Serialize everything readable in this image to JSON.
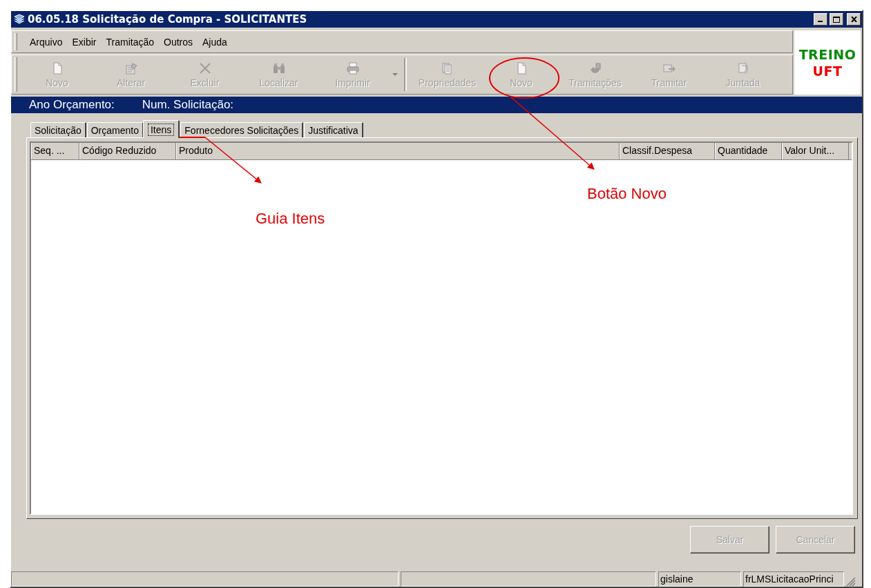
{
  "window": {
    "title": "06.05.18 Solicitação de Compra - SOLICITANTES"
  },
  "menu": [
    "Arquivo",
    "Exibir",
    "Tramitação",
    "Outros",
    "Ajuda"
  ],
  "toolbar": [
    {
      "kind": "button",
      "label": "Novo",
      "disabled": true
    },
    {
      "kind": "button",
      "label": "Alterar",
      "disabled": true
    },
    {
      "kind": "button",
      "label": "Excluir",
      "disabled": true
    },
    {
      "kind": "button",
      "label": "Localizar",
      "disabled": true
    },
    {
      "kind": "button",
      "label": "Imprimir",
      "disabled": true,
      "dropdown": true
    },
    {
      "kind": "separator"
    },
    {
      "kind": "button",
      "label": "Propriedades",
      "disabled": true
    },
    {
      "kind": "button",
      "label": "Novo",
      "disabled": true
    },
    {
      "kind": "button",
      "label": "Tramitações",
      "disabled": true
    },
    {
      "kind": "button",
      "label": "Tramitar",
      "disabled": true
    },
    {
      "kind": "button",
      "label": "Juntada",
      "disabled": true
    }
  ],
  "logo": {
    "line_1": "TREINO",
    "line_2": "UFT"
  },
  "info_bar": [
    "Ano Orçamento:",
    "Num. Solicitação:"
  ],
  "tabs": [
    {
      "label": "Solicitação",
      "selected": false
    },
    {
      "label": "Orçamento",
      "selected": false
    },
    {
      "label": "Itens",
      "selected": true
    },
    {
      "label": "Fornecedores Solicitações",
      "selected": false
    },
    {
      "label": "Justificativa",
      "selected": false
    }
  ],
  "table": {
    "columns": [
      "Seq. ...",
      "Código Reduzido",
      "Produto",
      "Classif.Despesa",
      "Quantidade",
      "Valor Unit..."
    ]
  },
  "buttons": [
    {
      "label": "Salvar",
      "disabled": true
    },
    {
      "label": "Cancelar",
      "disabled": true
    }
  ],
  "status_bar": [
    "gislaine",
    "frLMSLicitacaoPrinci"
  ],
  "annotations": [
    {
      "kind": "tab",
      "text": "Guia Itens"
    },
    {
      "kind": "button",
      "text": "Botão Novo"
    }
  ]
}
